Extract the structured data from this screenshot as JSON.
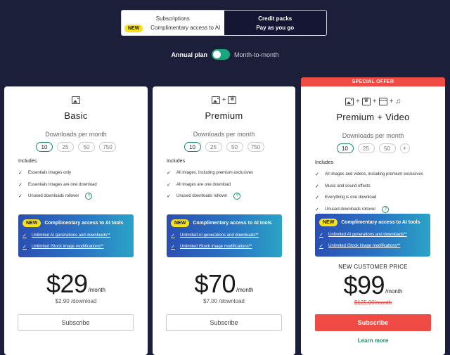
{
  "plan_switch": {
    "subscriptions": {
      "title": "Subscriptions",
      "badge": "NEW",
      "subtitle": "Complimentary access to AI"
    },
    "credit_packs": {
      "title": "Credit packs",
      "subtitle": "Pay as you go"
    }
  },
  "billing": {
    "annual_label": "Annual plan",
    "monthly_label": "Month-to-month",
    "toggle_state": "on"
  },
  "cards": [
    {
      "title": "Basic",
      "downloads_label": "Downloads per month",
      "options": [
        "10",
        "25",
        "50",
        "750"
      ],
      "selected_option": "10",
      "includes_label": "Includes",
      "features": [
        "Essentials images only",
        "Essentials images are one download",
        "Unused downloads rollover"
      ],
      "ai": {
        "badge": "NEW",
        "title": "Complimentary access to AI tools",
        "items": [
          "Unlimited AI generations and downloads**",
          "Unlimited iStock image modifications**"
        ]
      },
      "price": "$29",
      "per": "/month",
      "per_download": "$2.90 /download",
      "button": "Subscribe"
    },
    {
      "title": "Premium",
      "downloads_label": "Downloads per month",
      "options": [
        "10",
        "25",
        "50",
        "750"
      ],
      "selected_option": "10",
      "includes_label": "Includes",
      "features": [
        "All images, including premium exclusives",
        "All images are one download",
        "Unused downloads rollover"
      ],
      "ai": {
        "badge": "NEW",
        "title": "Complimentary access to AI tools",
        "items": [
          "Unlimited AI generations and downloads**",
          "Unlimited iStock image modifications**"
        ]
      },
      "price": "$70",
      "per": "/month",
      "per_download": "$7.00 /download",
      "button": "Subscribe"
    },
    {
      "banner": "SPECIAL OFFER",
      "title": "Premium + Video",
      "downloads_label": "Downloads per month",
      "options": [
        "10",
        "25",
        "50",
        "+"
      ],
      "selected_option": "10",
      "includes_label": "Includes",
      "features": [
        "All images and videos, including premium exclusives",
        "Music and sound effects",
        "Everything is one download",
        "Unused downloads rollover"
      ],
      "ai": {
        "badge": "NEW",
        "title": "Complimentary access to AI tools",
        "items": [
          "Unlimited AI generations and downloads**",
          "Unlimited iStock image modifications**"
        ]
      },
      "new_customer": "NEW CUSTOMER PRICE",
      "price": "$99",
      "per": "/month",
      "old_price": "$125.00/month",
      "button": "Subscribe",
      "learn_more": "Learn more"
    }
  ],
  "colors": {
    "background": "#1c1f3a",
    "accent_green": "#1a8d6a",
    "offer_red": "#f04a44",
    "badge_yellow": "#f7e219"
  },
  "icons": {
    "plus": "+",
    "help": "?",
    "check": "✓",
    "music": "♫"
  }
}
